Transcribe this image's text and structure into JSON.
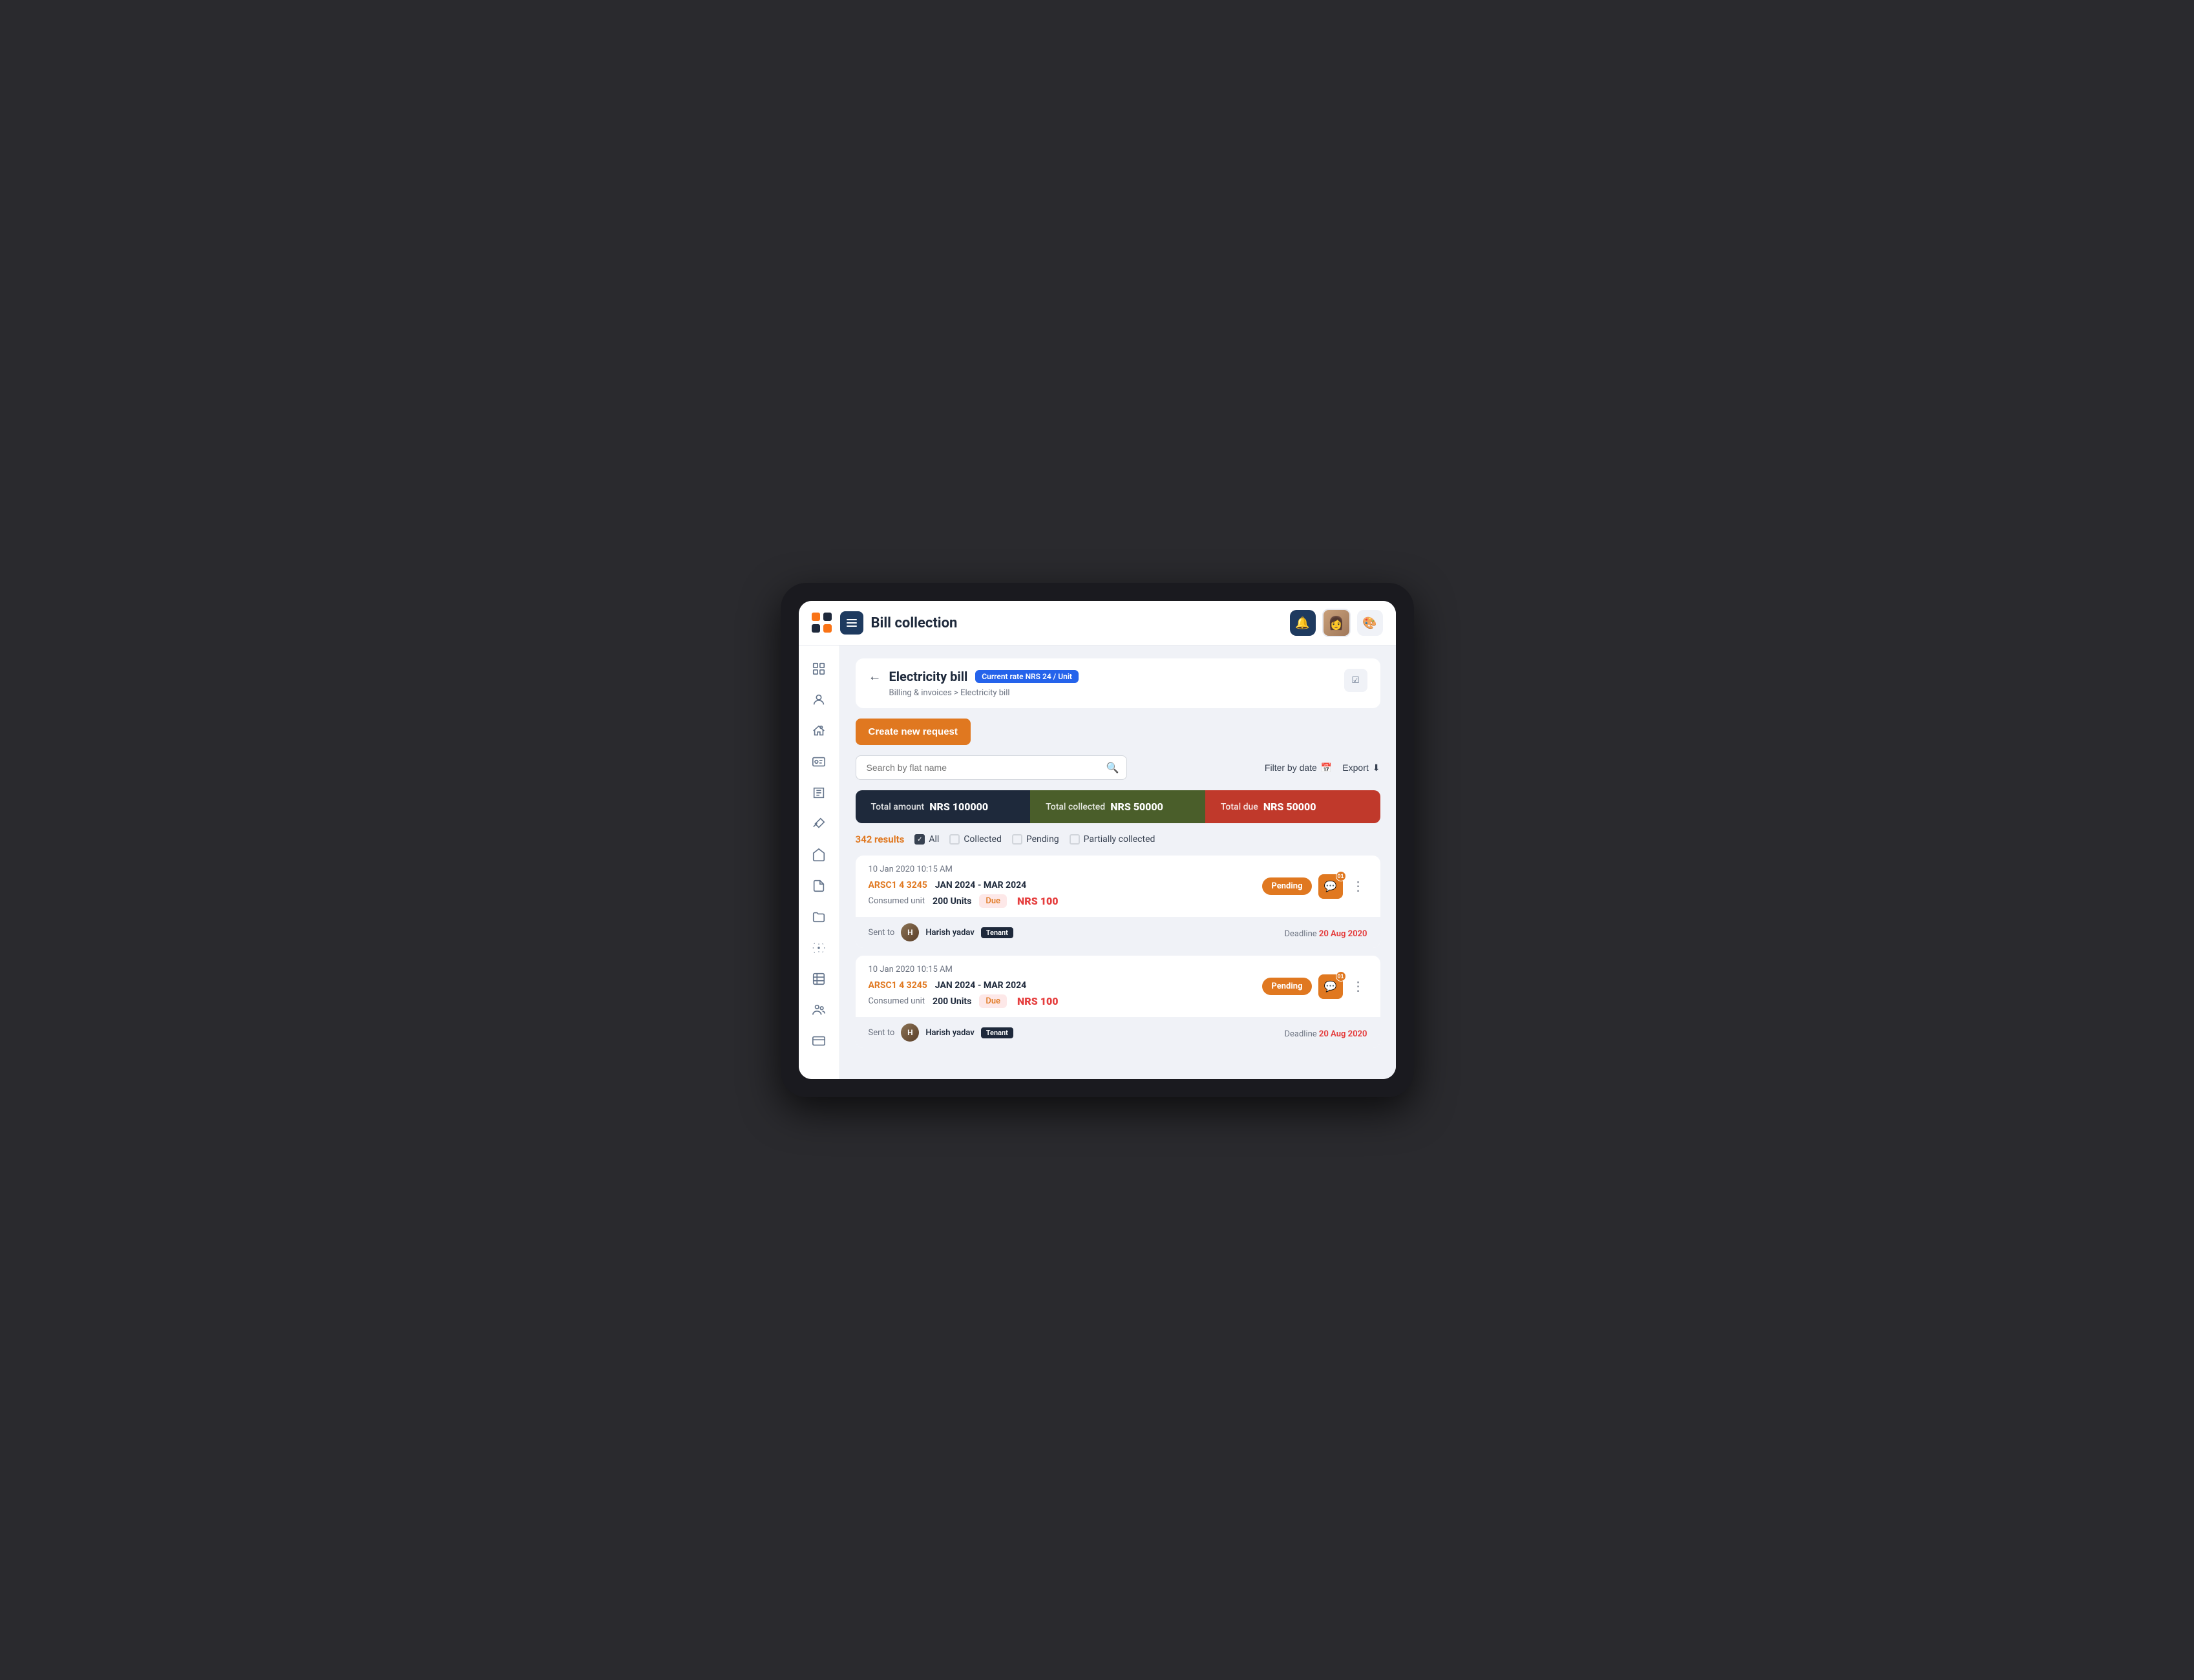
{
  "header": {
    "title": "Bill collection",
    "menu_label": "Menu",
    "notification_icon": "bell",
    "settings_icon": "palette"
  },
  "sidebar": {
    "items": [
      {
        "id": "dashboard",
        "icon": "grid"
      },
      {
        "id": "user",
        "icon": "user-circle"
      },
      {
        "id": "home-user",
        "icon": "home-user"
      },
      {
        "id": "id-card",
        "icon": "id-card"
      },
      {
        "id": "bills",
        "icon": "bills"
      },
      {
        "id": "maintenance",
        "icon": "maintenance"
      },
      {
        "id": "amenities",
        "icon": "amenities"
      },
      {
        "id": "documents",
        "icon": "documents"
      },
      {
        "id": "folder",
        "icon": "folder"
      },
      {
        "id": "alerts",
        "icon": "alerts"
      },
      {
        "id": "grid-2",
        "icon": "grid-2"
      },
      {
        "id": "people",
        "icon": "people"
      },
      {
        "id": "payment",
        "icon": "payment"
      }
    ]
  },
  "page": {
    "back_icon": "←",
    "title": "Electricity bill",
    "rate_badge": "Current rate  NRS 24 / Unit",
    "breadcrumb_link": "Billing & invoices",
    "breadcrumb_separator": ">",
    "breadcrumb_current": "Electricity bill",
    "filter_icon": "checklist"
  },
  "create_button": {
    "label": "Create new request"
  },
  "search": {
    "placeholder": "Search by flat name",
    "filter_date_label": "Filter by date",
    "export_label": "Export"
  },
  "stats": {
    "total_amount_label": "Total amount",
    "total_amount_value": "NRS 100000",
    "total_collected_label": "Total collected",
    "total_collected_value": "NRS 50000",
    "total_due_label": "Total due",
    "total_due_value": "NRS 50000"
  },
  "filters": {
    "results_count": "342 results",
    "options": [
      {
        "id": "all",
        "label": "All",
        "checked": true
      },
      {
        "id": "collected",
        "label": "Collected",
        "checked": false
      },
      {
        "id": "pending",
        "label": "Pending",
        "checked": false
      },
      {
        "id": "partially",
        "label": "Partially collected",
        "checked": false
      }
    ]
  },
  "bills": [
    {
      "date": "10 Jan 2020 10:15 AM",
      "flat": "ARSC1 4 3245",
      "period": "JAN 2024 - MAR 2024",
      "unit_label": "Consumed unit",
      "unit_value": "200 Units",
      "due_label": "Due",
      "due_currency": "NRS",
      "due_amount": "100",
      "status": "Pending",
      "status_type": "pending",
      "msg_count": "01",
      "sent_to_label": "Sent to",
      "tenant_name": "Harish yadav",
      "tenant_role": "Tenant",
      "deadline_label": "Deadline",
      "deadline_value": "20 Aug 2020"
    },
    {
      "date": "10 Jan 2020 10:15 AM",
      "flat": "ARSC1 4 3245",
      "period": "JAN 2024 - MAR 2024",
      "unit_label": "Consumed unit",
      "unit_value": "200 Units",
      "due_label": "Due",
      "due_currency": "NRS",
      "due_amount": "100",
      "status": "Pending",
      "status_type": "pending",
      "msg_count": "01",
      "sent_to_label": "Sent to",
      "tenant_name": "Harish yadav",
      "tenant_role": "Tenant",
      "deadline_label": "Deadline",
      "deadline_value": "20 Aug 2020"
    }
  ]
}
